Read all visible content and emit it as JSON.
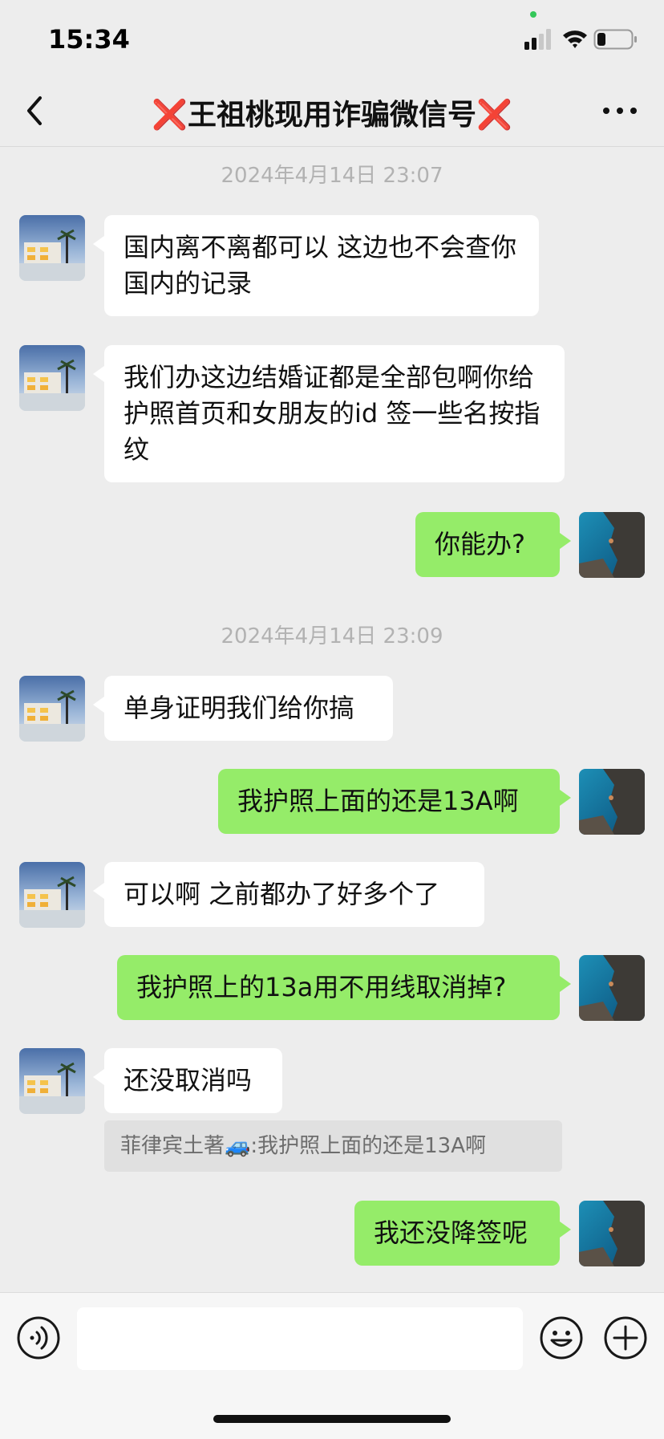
{
  "status_bar": {
    "time": "15:34"
  },
  "nav": {
    "title": "❌王祖桃现用诈骗微信号❌"
  },
  "timestamps": [
    "2024年4月14日 23:07",
    "2024年4月14日 23:09"
  ],
  "messages": [
    {
      "side": "left",
      "text": "国内离不离都可以 这边也不会查你国内的记录"
    },
    {
      "side": "left",
      "text": "我们办这边结婚证都是全部包啊你给护照首页和女朋友的id 签一些名按指纹"
    },
    {
      "side": "right",
      "text": "你能办?"
    },
    {
      "side": "left",
      "text": "单身证明我们给你搞"
    },
    {
      "side": "right",
      "text": "我护照上面的还是13A啊"
    },
    {
      "side": "left",
      "text": "可以啊 之前都办了好多个了"
    },
    {
      "side": "right",
      "text": "我护照上的13a用不用线取消掉?"
    },
    {
      "side": "left",
      "text": "还没取消吗"
    },
    {
      "side": "right",
      "text": "我还没降签呢"
    }
  ],
  "quote": {
    "text": "菲律宾土著🚙:我护照上面的还是13A啊"
  },
  "input": {
    "placeholder": ""
  },
  "icons": {
    "back": "chevron-left-icon",
    "more": "more-dots-icon",
    "voice": "voice-icon",
    "emoji": "emoji-icon",
    "plus": "plus-icon"
  },
  "colors": {
    "outgoing_bubble": "#95ec69",
    "incoming_bubble": "#ffffff",
    "background": "#ededed"
  }
}
